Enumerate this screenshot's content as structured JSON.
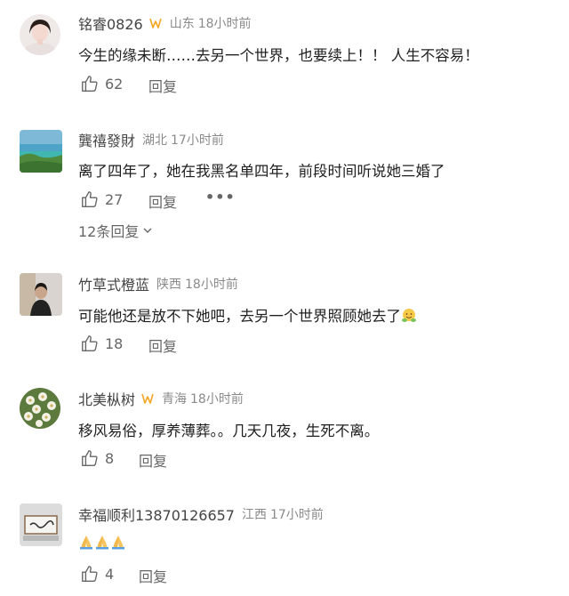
{
  "comments": [
    {
      "username": "铭睿0826",
      "location": "山东",
      "time": "18小时前",
      "text": "今生的缘未断……去另一个世界，也要续上！！ 人生不容易！",
      "likes": "62",
      "reply_label": "回复",
      "verified": true
    },
    {
      "username": "龔禧發財",
      "location": "湖北",
      "time": "17小时前",
      "text": "离了四年了，她在我黑名单四年，前段时间听说她三婚了",
      "likes": "27",
      "reply_label": "回复",
      "more_label": "•••",
      "replies_link": "12条回复",
      "verified": false
    },
    {
      "username": "竹草式橙蓝",
      "location": "陕西",
      "time": "18小时前",
      "text": "可能他还是放不下她吧，去另一个世界照顾她去了",
      "likes": "18",
      "reply_label": "回复",
      "verified": false
    },
    {
      "username": "北美枞树",
      "location": "青海",
      "time": "18小时前",
      "text": "移风易俗，厚养薄葬。。几天几夜，生死不离。",
      "likes": "8",
      "reply_label": "回复",
      "verified": true
    },
    {
      "username": "幸福顺利13870126657",
      "location": "江西",
      "time": "17小时前",
      "text": "",
      "likes": "4",
      "reply_label": "回复",
      "verified": false
    }
  ],
  "colors": {
    "username": "#444444",
    "meta": "#8a8a8a",
    "badge": "#f5a623",
    "icon": "#666666"
  },
  "icons": [
    "thumbs-up-icon",
    "verified-badge-icon",
    "chevron-down-icon",
    "hug-emoji-icon",
    "pray-emoji-icon"
  ]
}
